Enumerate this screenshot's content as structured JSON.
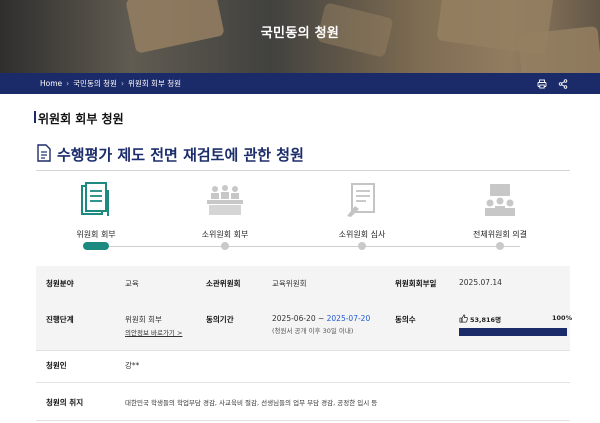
{
  "hero": {
    "title": "국민동의 청원"
  },
  "breadcrumb": [
    "Home",
    "국민동의 청원",
    "위원회 회부 청원"
  ],
  "section": {
    "title": "위원회 회부 청원"
  },
  "petition": {
    "title": "수행평가 제도 전면 재검토에 관한 청원"
  },
  "steps": [
    {
      "label": "위원회 회부",
      "icon": "document-stack-icon",
      "active": true
    },
    {
      "label": "소위원회 회부",
      "icon": "meeting-icon",
      "active": false
    },
    {
      "label": "소위원회 심사",
      "icon": "review-icon",
      "active": false
    },
    {
      "label": "전체위원회 의결",
      "icon": "vote-icon",
      "active": false
    }
  ],
  "info": {
    "field_label": "청원분야",
    "field_value": "교육",
    "committee_label": "소관위원회",
    "committee_value": "교육위원회",
    "referral_date_label": "위원회회부일",
    "referral_date_value": "2025.07.14",
    "stage_label": "진행단계",
    "stage_value": "위원회 회부",
    "stage_link": "의안정보 바로가기 >",
    "period_label": "동의기간",
    "period_start": "2025-06-20 ~ ",
    "period_end": "2025-07-20",
    "period_note": "(청원서 공개 이후 30일 이내)",
    "count_label": "동의수",
    "count_value": "53,816명",
    "count_percent_label": "100%",
    "count_progress": 1.0,
    "petitioner_label": "청원인",
    "petitioner_value": "강**",
    "purpose_label": "청원의 취지",
    "purpose_value": "대한민국 학생들의 학업부담 경감, 사교육비 절감, 선생님들의 업무 부담 경감, 공정한 입시 등"
  },
  "colors": {
    "navy": "#1b2a69",
    "teal": "#1c8a7f",
    "link_blue": "#1f5bd6"
  }
}
